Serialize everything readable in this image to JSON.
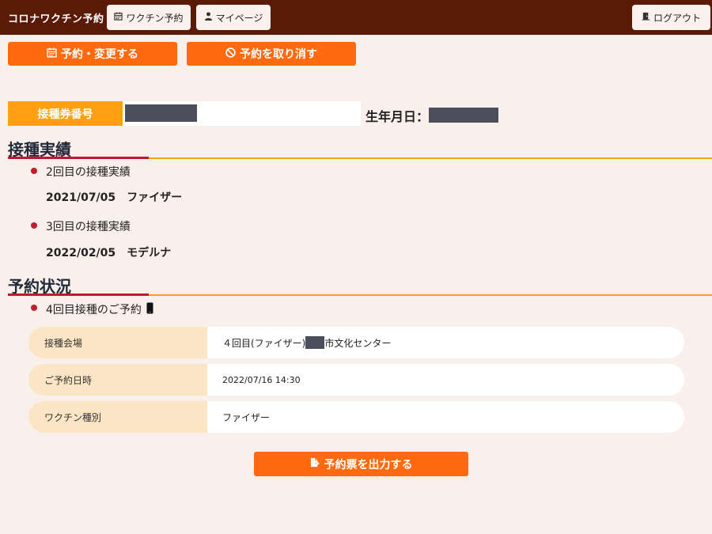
{
  "header": {
    "app_title": "コロナワクチン予約",
    "vaccine_reserve_label": "ワクチン予約",
    "mypage_label": "マイページ",
    "logout_label": "ログアウト"
  },
  "actions": {
    "reserve_change_label": "予約・変更する",
    "cancel_label": "予約を取り消す",
    "print_ticket_label": "予約票を出力する"
  },
  "ticket": {
    "label": "接種券番号",
    "dob_label": "生年月日："
  },
  "history": {
    "title": "接種実績",
    "items": [
      {
        "title": "2回目の接種実績",
        "date": "2021/07/05",
        "vaccine": "ファイザー"
      },
      {
        "title": "3回目の接種実績",
        "date": "2022/02/05",
        "vaccine": "モデルナ"
      }
    ]
  },
  "reservation": {
    "title": "予約状況",
    "item_title": "4回目接種のご予約",
    "rows": [
      {
        "label": "接種会場",
        "value_prefix": "４回目(ファイザー)",
        "value_suffix": "市文化センター"
      },
      {
        "label": "ご予約日時",
        "value": "2022/07/16 14:30"
      },
      {
        "label": "ワクチン種別",
        "value": "ファイザー"
      }
    ]
  },
  "colors": {
    "header_bg": "#5b1a06",
    "accent_orange": "#ff6a10",
    "ticket_orange": "#ffa012",
    "bullet_red": "#c41d2e",
    "row_label_bg": "#fbe5c4",
    "page_bg": "#f9efeb"
  },
  "icons": {
    "vaccine_reserve": "calendar-icon",
    "mypage": "user-icon",
    "logout": "door-exit-icon",
    "reserve_change": "calendar-icon",
    "cancel": "ban-icon",
    "reservation_item": "smartphone-icon",
    "print_ticket": "file-export-icon"
  }
}
